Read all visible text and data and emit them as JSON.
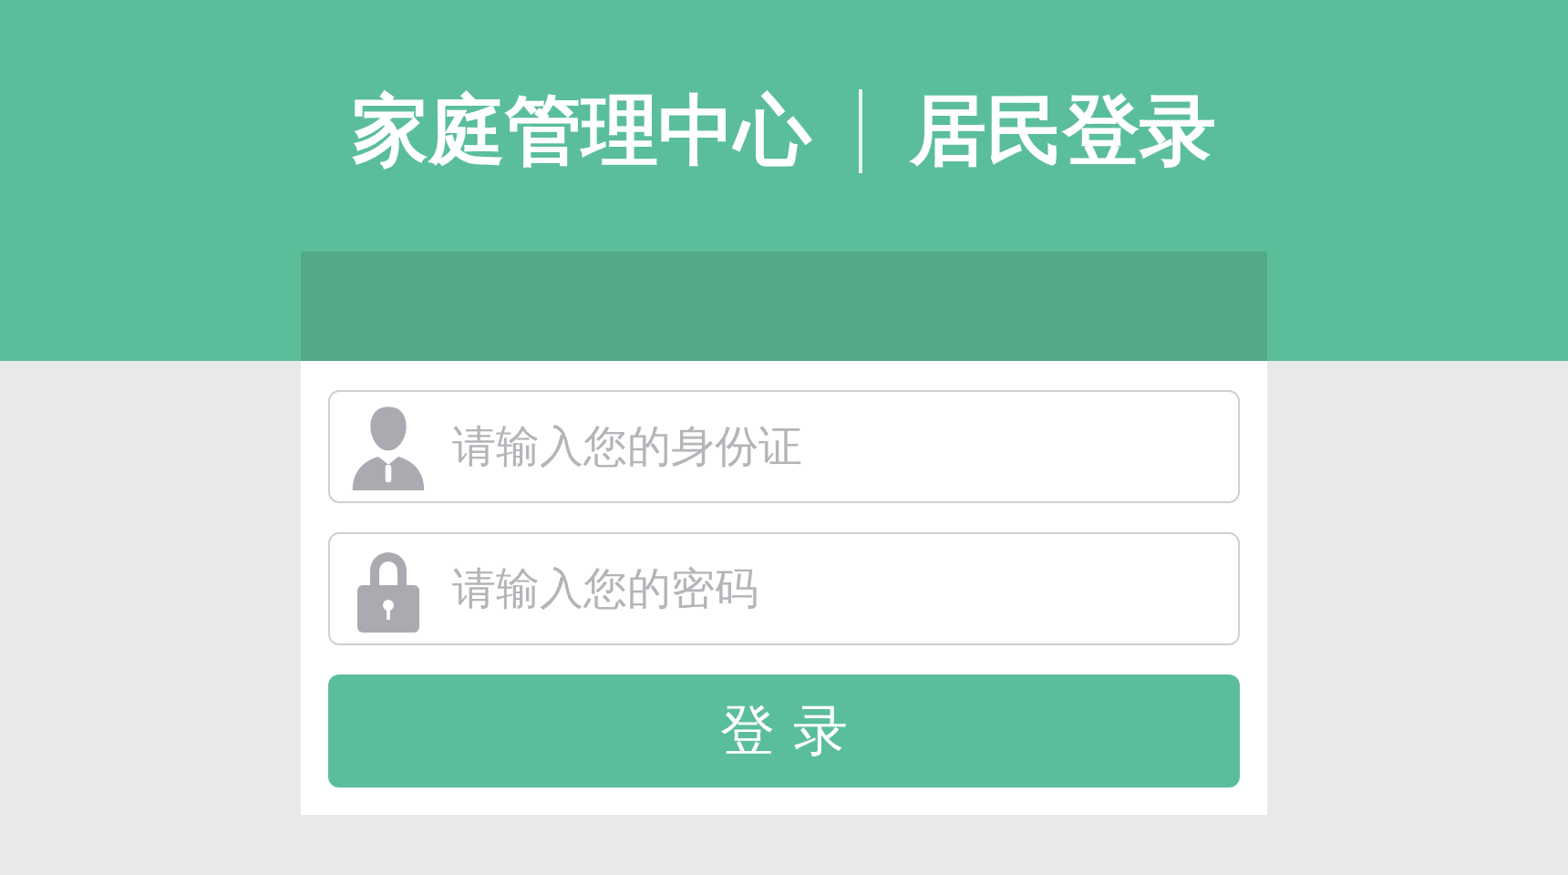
{
  "header": {
    "title": "家庭管理中心",
    "subtitle": "居民登录"
  },
  "fields": [
    {
      "kind": "user",
      "placeholder": "请输入您的身份证"
    },
    {
      "kind": "password",
      "placeholder": "请输入您的密码"
    }
  ],
  "login_button": {
    "label": "登 录"
  }
}
